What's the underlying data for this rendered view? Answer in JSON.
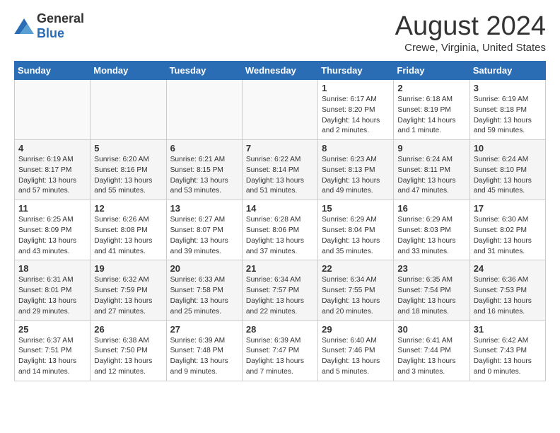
{
  "header": {
    "logo_general": "General",
    "logo_blue": "Blue",
    "month_title": "August 2024",
    "location": "Crewe, Virginia, United States"
  },
  "days_of_week": [
    "Sunday",
    "Monday",
    "Tuesday",
    "Wednesday",
    "Thursday",
    "Friday",
    "Saturday"
  ],
  "weeks": [
    [
      {
        "day": "",
        "info": ""
      },
      {
        "day": "",
        "info": ""
      },
      {
        "day": "",
        "info": ""
      },
      {
        "day": "",
        "info": ""
      },
      {
        "day": "1",
        "info": "Sunrise: 6:17 AM\nSunset: 8:20 PM\nDaylight: 14 hours\nand 2 minutes."
      },
      {
        "day": "2",
        "info": "Sunrise: 6:18 AM\nSunset: 8:19 PM\nDaylight: 14 hours\nand 1 minute."
      },
      {
        "day": "3",
        "info": "Sunrise: 6:19 AM\nSunset: 8:18 PM\nDaylight: 13 hours\nand 59 minutes."
      }
    ],
    [
      {
        "day": "4",
        "info": "Sunrise: 6:19 AM\nSunset: 8:17 PM\nDaylight: 13 hours\nand 57 minutes."
      },
      {
        "day": "5",
        "info": "Sunrise: 6:20 AM\nSunset: 8:16 PM\nDaylight: 13 hours\nand 55 minutes."
      },
      {
        "day": "6",
        "info": "Sunrise: 6:21 AM\nSunset: 8:15 PM\nDaylight: 13 hours\nand 53 minutes."
      },
      {
        "day": "7",
        "info": "Sunrise: 6:22 AM\nSunset: 8:14 PM\nDaylight: 13 hours\nand 51 minutes."
      },
      {
        "day": "8",
        "info": "Sunrise: 6:23 AM\nSunset: 8:13 PM\nDaylight: 13 hours\nand 49 minutes."
      },
      {
        "day": "9",
        "info": "Sunrise: 6:24 AM\nSunset: 8:11 PM\nDaylight: 13 hours\nand 47 minutes."
      },
      {
        "day": "10",
        "info": "Sunrise: 6:24 AM\nSunset: 8:10 PM\nDaylight: 13 hours\nand 45 minutes."
      }
    ],
    [
      {
        "day": "11",
        "info": "Sunrise: 6:25 AM\nSunset: 8:09 PM\nDaylight: 13 hours\nand 43 minutes."
      },
      {
        "day": "12",
        "info": "Sunrise: 6:26 AM\nSunset: 8:08 PM\nDaylight: 13 hours\nand 41 minutes."
      },
      {
        "day": "13",
        "info": "Sunrise: 6:27 AM\nSunset: 8:07 PM\nDaylight: 13 hours\nand 39 minutes."
      },
      {
        "day": "14",
        "info": "Sunrise: 6:28 AM\nSunset: 8:06 PM\nDaylight: 13 hours\nand 37 minutes."
      },
      {
        "day": "15",
        "info": "Sunrise: 6:29 AM\nSunset: 8:04 PM\nDaylight: 13 hours\nand 35 minutes."
      },
      {
        "day": "16",
        "info": "Sunrise: 6:29 AM\nSunset: 8:03 PM\nDaylight: 13 hours\nand 33 minutes."
      },
      {
        "day": "17",
        "info": "Sunrise: 6:30 AM\nSunset: 8:02 PM\nDaylight: 13 hours\nand 31 minutes."
      }
    ],
    [
      {
        "day": "18",
        "info": "Sunrise: 6:31 AM\nSunset: 8:01 PM\nDaylight: 13 hours\nand 29 minutes."
      },
      {
        "day": "19",
        "info": "Sunrise: 6:32 AM\nSunset: 7:59 PM\nDaylight: 13 hours\nand 27 minutes."
      },
      {
        "day": "20",
        "info": "Sunrise: 6:33 AM\nSunset: 7:58 PM\nDaylight: 13 hours\nand 25 minutes."
      },
      {
        "day": "21",
        "info": "Sunrise: 6:34 AM\nSunset: 7:57 PM\nDaylight: 13 hours\nand 22 minutes."
      },
      {
        "day": "22",
        "info": "Sunrise: 6:34 AM\nSunset: 7:55 PM\nDaylight: 13 hours\nand 20 minutes."
      },
      {
        "day": "23",
        "info": "Sunrise: 6:35 AM\nSunset: 7:54 PM\nDaylight: 13 hours\nand 18 minutes."
      },
      {
        "day": "24",
        "info": "Sunrise: 6:36 AM\nSunset: 7:53 PM\nDaylight: 13 hours\nand 16 minutes."
      }
    ],
    [
      {
        "day": "25",
        "info": "Sunrise: 6:37 AM\nSunset: 7:51 PM\nDaylight: 13 hours\nand 14 minutes."
      },
      {
        "day": "26",
        "info": "Sunrise: 6:38 AM\nSunset: 7:50 PM\nDaylight: 13 hours\nand 12 minutes."
      },
      {
        "day": "27",
        "info": "Sunrise: 6:39 AM\nSunset: 7:48 PM\nDaylight: 13 hours\nand 9 minutes."
      },
      {
        "day": "28",
        "info": "Sunrise: 6:39 AM\nSunset: 7:47 PM\nDaylight: 13 hours\nand 7 minutes."
      },
      {
        "day": "29",
        "info": "Sunrise: 6:40 AM\nSunset: 7:46 PM\nDaylight: 13 hours\nand 5 minutes."
      },
      {
        "day": "30",
        "info": "Sunrise: 6:41 AM\nSunset: 7:44 PM\nDaylight: 13 hours\nand 3 minutes."
      },
      {
        "day": "31",
        "info": "Sunrise: 6:42 AM\nSunset: 7:43 PM\nDaylight: 13 hours\nand 0 minutes."
      }
    ]
  ]
}
